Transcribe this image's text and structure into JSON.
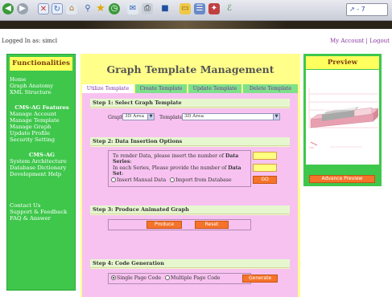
{
  "browser": {
    "address_text": "↗ - 7",
    "icons": [
      "back-icon",
      "forward-icon",
      "stop-icon",
      "refresh-icon",
      "home-icon",
      "search-icon",
      "favorites-icon",
      "history-icon",
      "mail-icon",
      "print-icon",
      "edit-icon",
      "folder-icon",
      "messenger-icon",
      "tools-icon"
    ]
  },
  "header": {
    "logged_in": "Logged In as: simcl",
    "my_account": "My Account",
    "separator": "|",
    "logout": "Logout"
  },
  "sidebar": {
    "title": "Functionalities",
    "group1": [
      "Home",
      "Graph Anatomy",
      "XML Structure"
    ],
    "group2_head": "CMS-AG Features",
    "group2": [
      "Manage Account",
      "Manage Template",
      "Manage Graph",
      "Update Profile",
      "Security Setting"
    ],
    "group3_head": "CMS-AG",
    "group3": [
      "System Architecture",
      "Database Dictionary",
      "Development Help"
    ],
    "group4": [
      "Contact Us",
      "Support & Feedback",
      "FAQ & Answer"
    ]
  },
  "main": {
    "title": "Graph Template Management",
    "tabs": [
      "Utilize Template",
      "Create Template",
      "Update Template",
      "Delete Template"
    ],
    "step1": {
      "heading": "Step 1: Select Graph Template",
      "graph_label": "Graph:",
      "graph_value": "3D Area",
      "template_label": "Template:",
      "template_value": "3D Area"
    },
    "step2": {
      "heading": "Step 2: Data Insertion Options",
      "series_text_pre": "To render Data, please insert the number of ",
      "series_text_bold": "Data Series",
      "series_text_post": ":",
      "set_text_pre": "In each Series, Please provide the number of ",
      "set_text_bold": "Data Set",
      "set_text_post": ":",
      "option_manual": "Insert Manual Data",
      "option_db": "Import from Database",
      "go_label": "GO"
    },
    "step3": {
      "heading": "Step 3: Produce Animated Graph",
      "produce_label": "Produce",
      "reset_label": "Reset"
    },
    "step4": {
      "heading": "Step 4: Code Generation",
      "option_single": "Single Page Code",
      "option_multi": "Multiple Page Code",
      "generate_label": "Generate"
    }
  },
  "preview": {
    "title": "Preview",
    "button_label": "Advance Preview"
  }
}
